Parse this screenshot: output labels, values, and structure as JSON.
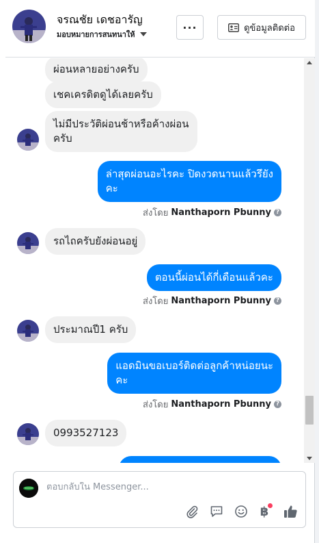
{
  "header": {
    "contact_name": "จรณชัย เดชอารัญ",
    "assignee": "มอบหมายการสนทนาให้",
    "more_label": "···",
    "contact_info_label": "ดูข้อมูลติดต่อ"
  },
  "messages": {
    "m1": "ผ่อนหลายอย่างครับ",
    "m2": "เชคเครดิตดูได้เลยครับ",
    "m3_line1": "ไม่มีประวัติผ่อนช้าหรือค้างผ่อน",
    "m3_line2": "ครับ",
    "m4_line1": "ล่าสุดผ่อนอะไรคะ ปิดงวดนานแล้วรึยัง",
    "m4_line2": "คะ",
    "m5": "รถไถครับยังผ่อนอยู่",
    "m6": "ตอนนี้ผ่อนได้กี่เดือนแล้วคะ",
    "m7": "ประมาณปี1 ครับ",
    "m8_line1": "แอดมินขอเบอร์ติดต่อลูกค้าหน่อยนะ",
    "m8_line2": "คะ",
    "m9": "0993527123"
  },
  "sent_by": {
    "prefix": "ส่งโดย",
    "name": "Nanthaporn Pbunny",
    "help": "?"
  },
  "composer": {
    "placeholder": "ตอบกลับใน Messenger...",
    "baht_symbol": "฿"
  },
  "colors": {
    "outgoing_bubble": "#0084ff",
    "incoming_bubble": "#f0f0f0",
    "like_button": "#606770",
    "notification_dot": "#fa3e5f"
  },
  "icons": [
    "more-icon",
    "contact-card-icon",
    "attachment-icon",
    "saved-reply-icon",
    "emoji-icon",
    "baht-icon",
    "thumbs-up-icon"
  ]
}
